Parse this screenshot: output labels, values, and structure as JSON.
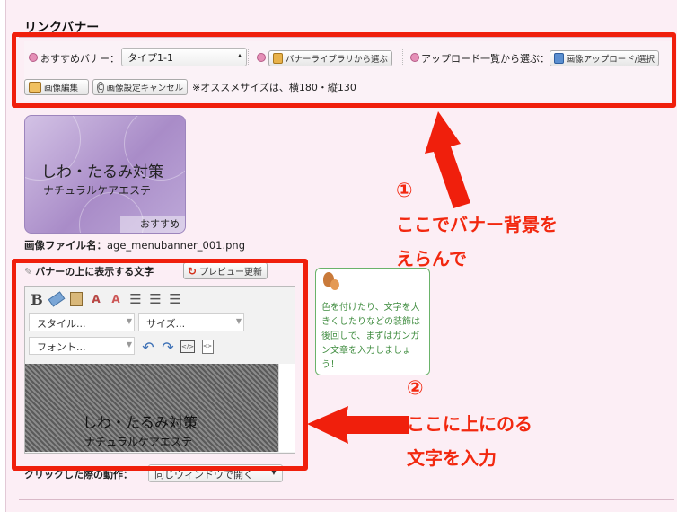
{
  "section_title": "リンクバナー",
  "toolbar": {
    "recommended_label": "おすすめバナー：",
    "recommended_value": "タイプ1-1",
    "library_button": "バナーライブラリから選ぶ",
    "upload_list_label": "アップロード一覧から選ぶ：",
    "upload_button": "画像アップロード/選択",
    "edit_button": "画像編集",
    "cancel_button": "画像設定キャンセル",
    "size_note": "※オススメサイズは、横180・縦130"
  },
  "banner": {
    "line1": "しわ・たるみ対策",
    "line2": "ナチュラルケアエステ",
    "tag": "おすすめ"
  },
  "filename": {
    "label": "画像ファイル名：",
    "value": "age_menubanner_001.png"
  },
  "overlay": {
    "label": "バナーの上に表示する文字",
    "preview_button": "プレビュー更新"
  },
  "editor": {
    "style_placeholder": "スタイル...",
    "size_placeholder": "サイズ...",
    "font_placeholder": "フォント...",
    "text_line1": "しわ・たるみ対策",
    "text_line2": "ナチュラルケアエステ"
  },
  "tip": {
    "text": "色を付けたり、文字を大きくしたりなどの装飾は後回しで、まずはガンガン文章を入力しましょう！"
  },
  "annotations": {
    "num1": "①",
    "text1_a": "ここでバナー背景を",
    "text1_b": "えらんで",
    "num2": "②",
    "text2_a": "ここに上にのる",
    "text2_b": "文字を入力"
  },
  "after_click": {
    "label": "クリックした際の動作：",
    "value": "同じウィンドウで開く"
  },
  "colors": {
    "annotation_red": "#f01f0c",
    "page_bg": "#fceef5",
    "tip_green": "#3f8c3f"
  }
}
